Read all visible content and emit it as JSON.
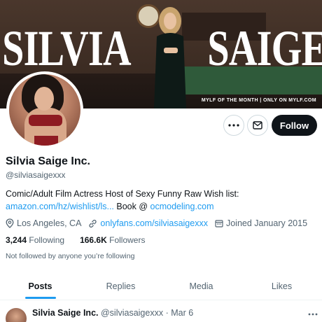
{
  "banner": {
    "title_left": "SILVIA",
    "title_right": "SAIGE",
    "tagline": "MYLF OF THE MONTH | ONLY ON MYLF.COM"
  },
  "actions": {
    "more_icon": "more-horizontal-icon",
    "message_icon": "mail-icon",
    "follow_label": "Follow"
  },
  "profile": {
    "name": "Silvia Saige Inc.",
    "handle": "@silviasaigexxx",
    "bio_line1": "Comic/Adult Film Actress Host of Sexy Funny Raw Wish list:",
    "bio_link1": "amazon.com/hz/wishlist/ls...",
    "bio_mid": " Book @ ",
    "bio_link2": "ocmodeling.com",
    "location": "Los Angeles, CA",
    "website": "onlyfans.com/silviasaigexxx",
    "joined": "Joined January 2015",
    "following_count": "3,244",
    "following_label": "Following",
    "followers_count": "166.6K",
    "followers_label": "Followers",
    "not_followed": "Not followed by anyone you’re following"
  },
  "tabs": [
    {
      "label": "Posts"
    },
    {
      "label": "Replies"
    },
    {
      "label": "Media"
    },
    {
      "label": "Likes"
    }
  ],
  "post": {
    "author": "Silvia Saige Inc.",
    "meta": "@silviasaigexxx · Mar 6"
  },
  "colors": {
    "accent": "#1d9bf0",
    "text": "#0f1419",
    "muted": "#536471"
  }
}
